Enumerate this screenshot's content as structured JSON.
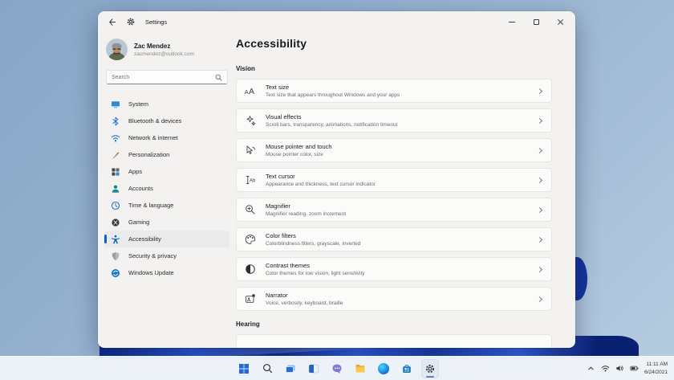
{
  "colors": {
    "accent": "#0067c0",
    "window_bg": "#f4f2f0",
    "card_bg": "#fbfbfa",
    "taskbar_bg": "#f0f4f9",
    "desktop_light_blue": "#9bb6d2",
    "bloom_blue": "#2c5ae0"
  },
  "window": {
    "titlebar": {
      "title": "Settings"
    },
    "profile": {
      "name": "Zac Mendez",
      "email": "zacmendez@outlook.com"
    },
    "search": {
      "placeholder": "Search"
    },
    "sidebar": {
      "items": [
        {
          "label": "System"
        },
        {
          "label": "Bluetooth & devices"
        },
        {
          "label": "Network & internet"
        },
        {
          "label": "Personalization"
        },
        {
          "label": "Apps"
        },
        {
          "label": "Accounts"
        },
        {
          "label": "Time & language"
        },
        {
          "label": "Gaming"
        },
        {
          "label": "Accessibility",
          "selected": true
        },
        {
          "label": "Security & privacy"
        },
        {
          "label": "Windows Update"
        }
      ]
    },
    "main": {
      "title": "Accessibility",
      "section_vision": "Vision",
      "section_hearing": "Hearing",
      "vision_items": [
        {
          "title": "Text size",
          "subtitle": "Text size that appears throughout Windows and your apps"
        },
        {
          "title": "Visual effects",
          "subtitle": "Scroll bars, transparency, animations, notification timeout"
        },
        {
          "title": "Mouse pointer and touch",
          "subtitle": "Mouse pointer color, size"
        },
        {
          "title": "Text cursor",
          "subtitle": "Appearance and thickness, text cursor indicator"
        },
        {
          "title": "Magnifier",
          "subtitle": "Magnifier reading, zoom increment"
        },
        {
          "title": "Color filters",
          "subtitle": "Colorblindness filters, grayscale, inverted"
        },
        {
          "title": "Contrast themes",
          "subtitle": "Color themes for low vision, light sensitivity"
        },
        {
          "title": "Narrator",
          "subtitle": "Voice, verbosity, keyboard, braille"
        }
      ]
    }
  },
  "taskbar": {
    "icons": [
      "start",
      "search",
      "task-view",
      "widgets",
      "chat",
      "file-explorer",
      "edge",
      "store",
      "settings"
    ],
    "active_icon": "settings",
    "tray": {
      "time": "11:11 AM",
      "date": "6/24/2021"
    }
  }
}
